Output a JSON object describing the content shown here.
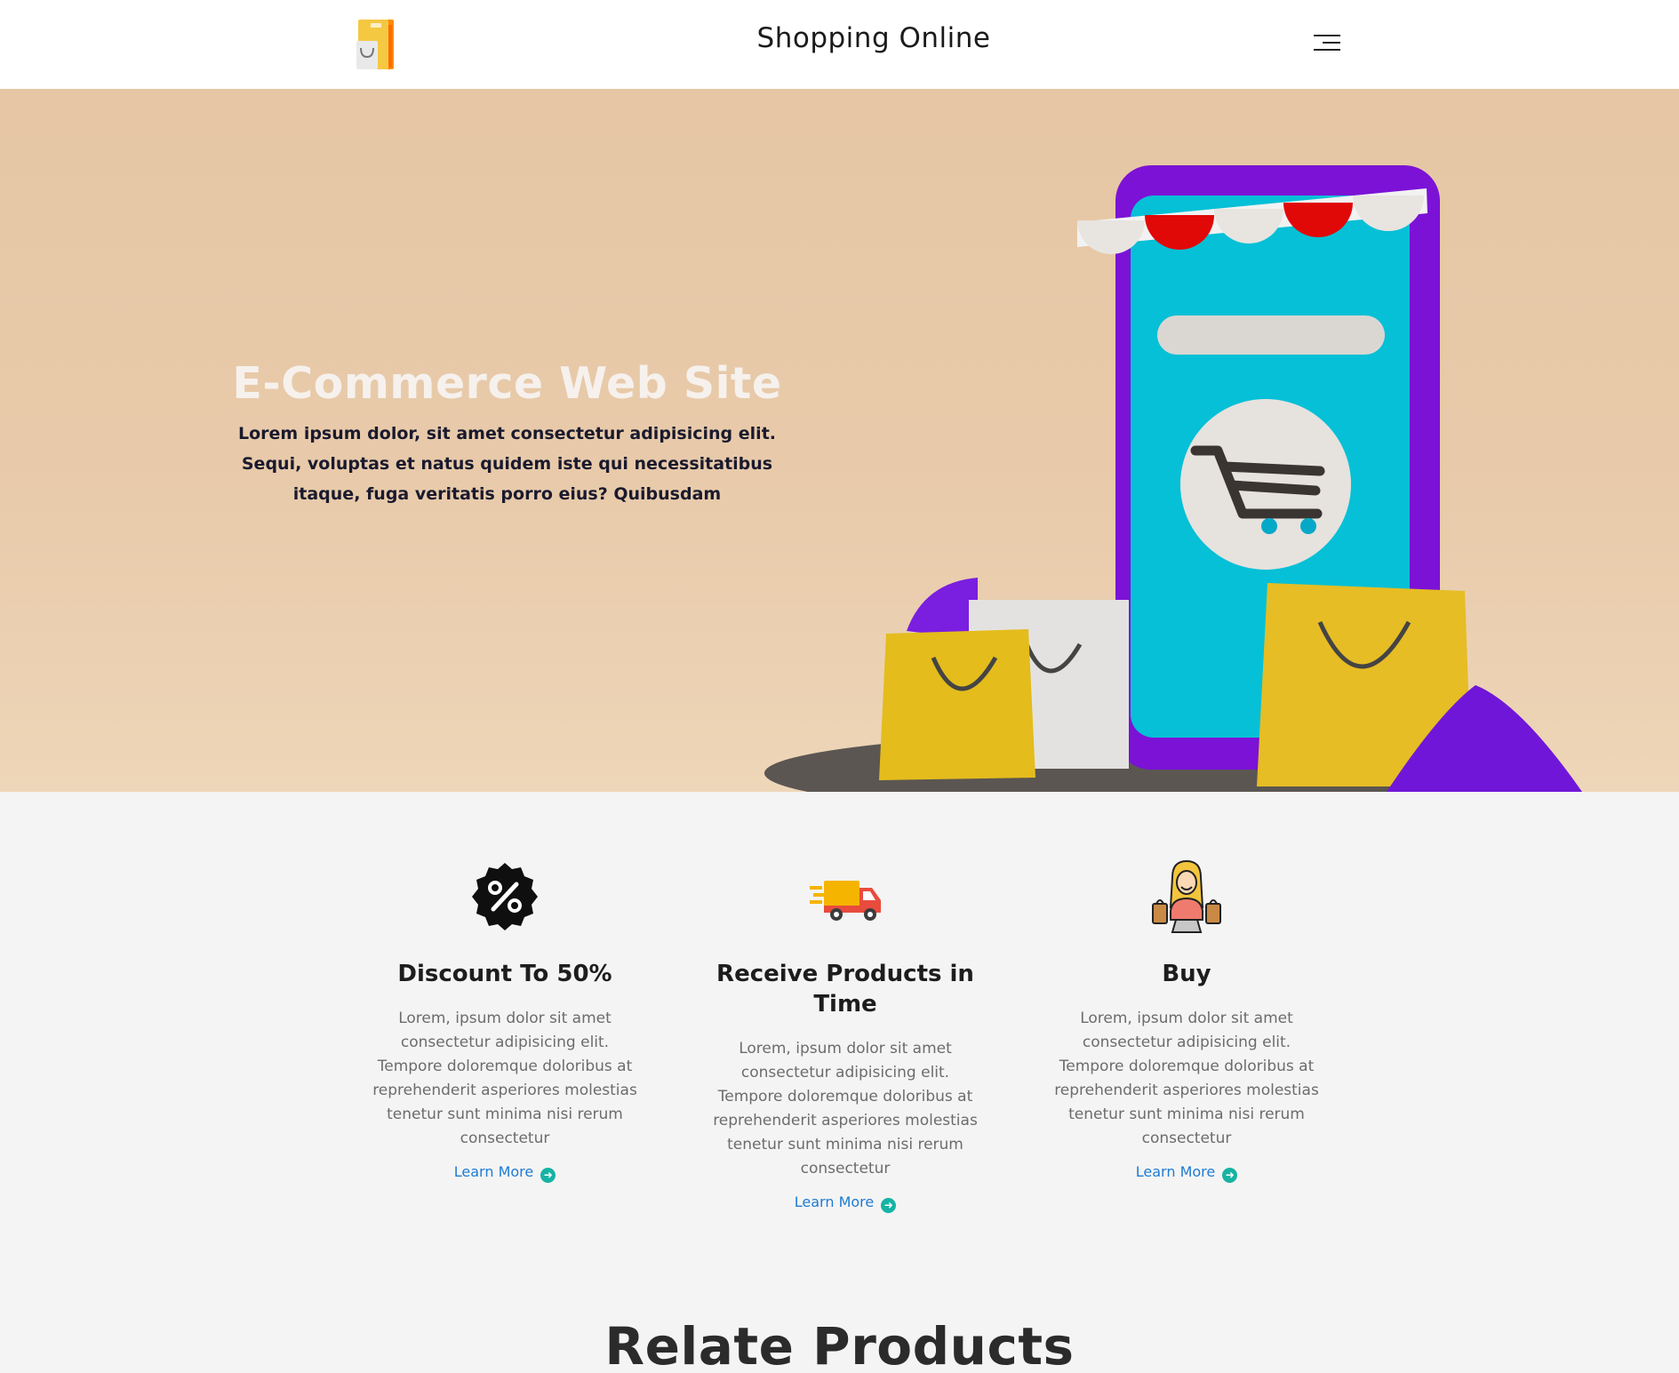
{
  "header": {
    "title": "Shopping Online",
    "logo_icon": "shopping-bag-logo",
    "menu_icon": "hamburger-menu-icon"
  },
  "hero": {
    "title": "E-Commerce Web Site",
    "description": "Lorem ipsum dolor, sit amet consectetur adipisicing elit. Sequi, voluptas et natus quidem iste qui necessitatibus itaque, fuga veritatis porro eius? Quibusdam",
    "illustration": "phone-store-with-shopping-bags"
  },
  "features": [
    {
      "icon": "discount-percent-icon",
      "title": "Discount To 50%",
      "text": "Lorem, ipsum dolor sit amet consectetur adipisicing elit. Tempore doloremque doloribus at reprehenderit asperiores molestias tenetur sunt minima nisi rerum consectetur",
      "link": "Learn More"
    },
    {
      "icon": "delivery-truck-icon",
      "title": "Receive Products in Time",
      "text": "Lorem, ipsum dolor sit amet consectetur adipisicing elit. Tempore doloremque doloribus at reprehenderit asperiores molestias tenetur sunt minima nisi rerum consectetur",
      "link": "Learn More"
    },
    {
      "icon": "shopper-woman-icon",
      "title": "Buy",
      "text": "Lorem, ipsum dolor sit amet consectetur adipisicing elit. Tempore doloremque doloribus at reprehenderit asperiores molestias tenetur sunt minima nisi rerum consectetur",
      "link": "Learn More"
    }
  ],
  "related": {
    "title": "Relate Products"
  },
  "colors": {
    "hero_bg": "#e6c6a4",
    "link": "#1e7bd4",
    "link_arrow": "#16b3a4",
    "page_bg": "#f4f4f4"
  }
}
